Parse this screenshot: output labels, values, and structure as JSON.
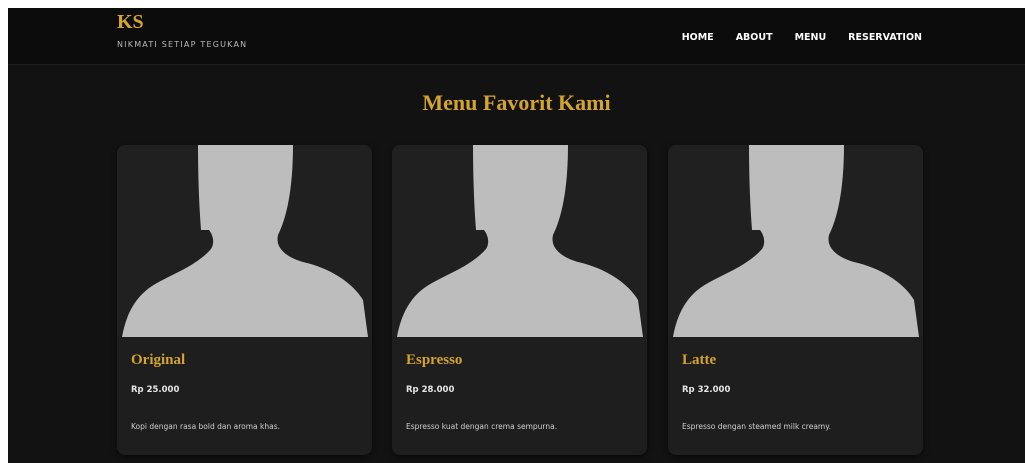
{
  "brand": {
    "title": "KS",
    "tagline": "NIKMATI SETIAP TEGUKAN"
  },
  "nav": {
    "items": [
      {
        "label": "HOME"
      },
      {
        "label": "ABOUT"
      },
      {
        "label": "MENU"
      },
      {
        "label": "RESERVATION"
      }
    ]
  },
  "section": {
    "title": "Menu Favorit Kami"
  },
  "colors": {
    "accent": "#d4a52c",
    "background": "#121212",
    "card": "#1e1e1e",
    "silhouette": "#bdbdbd"
  },
  "menu": {
    "items": [
      {
        "name": "Original",
        "price": "Rp 25.000",
        "description": "Kopi dengan rasa bold dan aroma khas.",
        "image": "person-silhouette-placeholder"
      },
      {
        "name": "Espresso",
        "price": "Rp 28.000",
        "description": "Espresso kuat dengan crema sempurna.",
        "image": "person-silhouette-placeholder"
      },
      {
        "name": "Latte",
        "price": "Rp 32.000",
        "description": "Espresso dengan steamed milk creamy.",
        "image": "person-silhouette-placeholder"
      }
    ]
  }
}
